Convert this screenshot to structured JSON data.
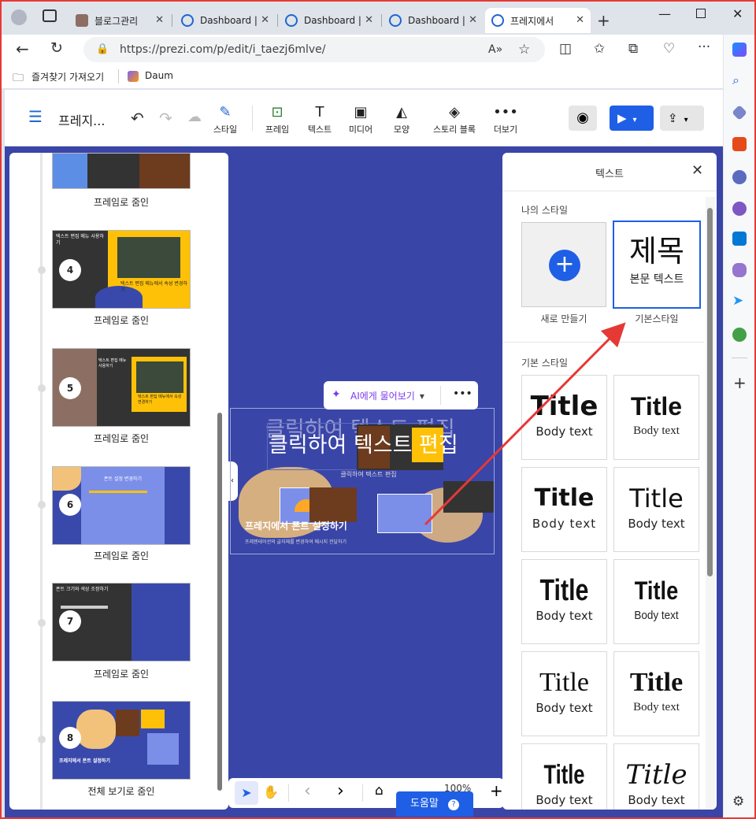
{
  "tabs": [
    {
      "label": "블로그관리",
      "active": false
    },
    {
      "label": "Dashboard |",
      "active": false
    },
    {
      "label": "Dashboard |",
      "active": false
    },
    {
      "label": "Dashboard |",
      "active": false
    },
    {
      "label": "프레지에서 ",
      "active": true
    }
  ],
  "address": {
    "url": "https://prezi.com/p/edit/i_taezj6mlve/"
  },
  "bookmarks": {
    "import": "즐겨찾기 가져오기",
    "daum": "Daum"
  },
  "toolbar": {
    "title": "프레지...",
    "style": "스타일",
    "frame": "프레임",
    "text": "텍스트",
    "media": "미디어",
    "shape": "모양",
    "story": "스토리 블록",
    "more": "더보기"
  },
  "frames": [
    {
      "num": "",
      "caption": "프레임로 줌인"
    },
    {
      "num": "4",
      "caption": "프레임로 줌인",
      "text": "텍스트 편집 메뉴 사용하기",
      "text2": "텍스트 편집 메뉴에서 속성 변경하기"
    },
    {
      "num": "5",
      "caption": "프레임로 줌인",
      "text": "텍스트 편집 메뉴 사용하기",
      "text2": "텍스트 편집 메뉴에서 속성 변경하기"
    },
    {
      "num": "6",
      "caption": "프레임로 줌인",
      "text": "폰트 설정 변경하기"
    },
    {
      "num": "7",
      "caption": "프레임로 줌인",
      "text": "폰트 크기와 색상 조정하기"
    },
    {
      "num": "8",
      "caption": "전체 보기로 줌인",
      "text": "프레지에서 폰트 설정하기"
    }
  ],
  "canvas": {
    "heading": "클릭하여 텍스트 편집",
    "subheading": "클릭하여 텍스트 편집",
    "main_title": "프레지에서 폰트 설정하기",
    "main_sub": "프레젠테이션의 글자체를 변경하여 메시지 전달하기",
    "ai_label": "AI에게 물어보기"
  },
  "panel": {
    "title": "텍스트",
    "my_styles": "나의 스타일",
    "new_label": "새로 만들기",
    "default_style_label": "기본스타일",
    "default_style_title": "제목",
    "default_style_body": "본문 텍스트",
    "basic_styles": "기본 스타일",
    "cards": [
      {
        "title": "Title",
        "body": "Body text"
      },
      {
        "title": "Title",
        "body": "Body text"
      },
      {
        "title": "Title",
        "body": "Body text"
      },
      {
        "title": "Title",
        "body": "Body text"
      },
      {
        "title": "Title",
        "body": "Body text"
      },
      {
        "title": "Title",
        "body": "Body text"
      },
      {
        "title": "Title",
        "body": "Body text"
      },
      {
        "title": "Title",
        "body": "Body text"
      },
      {
        "title": "Title",
        "body": "Body text"
      },
      {
        "title": "Title",
        "body": "Body text"
      }
    ]
  },
  "bottom": {
    "zoom": "100%",
    "help": "도움말"
  },
  "colors": {
    "accent": "#1f5fe6",
    "canvas": "#3a45a8",
    "yellow": "#ffc107",
    "annotation": "#e53935"
  }
}
